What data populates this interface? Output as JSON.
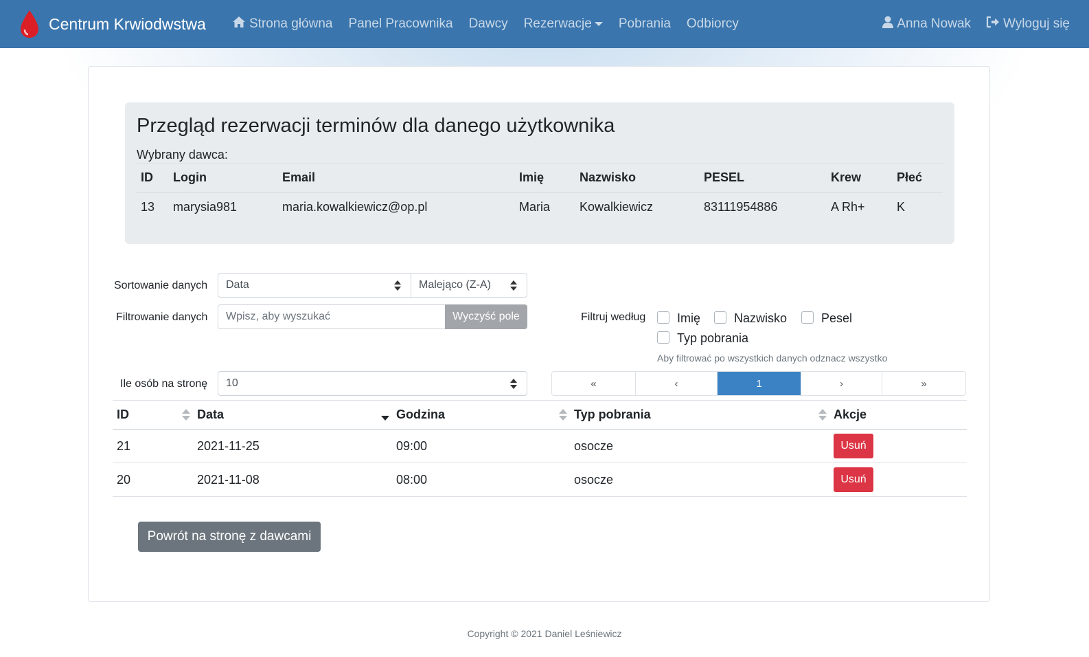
{
  "navbar": {
    "brand": "Centrum Krwiodwstwa",
    "links": [
      "Strona główna",
      "Panel Pracownika",
      "Dawcy",
      "Rezerwacje",
      "Pobrania",
      "Odbiorcy"
    ],
    "user": "Anna Nowak",
    "logout": "Wyloguj się",
    "color": "#3a75ad"
  },
  "header": {
    "title": "Przegląd rezerwacji terminów dla danego użytkownika",
    "subtitle": "Wybrany dawca:"
  },
  "donor": {
    "columns": [
      "ID",
      "Login",
      "Email",
      "Imię",
      "Nazwisko",
      "PESEL",
      "Krew",
      "Płeć"
    ],
    "row": [
      "13",
      "marysia981",
      "maria.kowalkiewicz@op.pl",
      "Maria",
      "Kowalkiewicz",
      "83111954886",
      "A Rh+",
      "K"
    ]
  },
  "controls": {
    "sort_label": "Sortowanie danych",
    "sort_field": "Data",
    "sort_order": "Malejąco (Z-A)",
    "filter_label": "Filtrowanie danych",
    "filter_placeholder": "Wpisz, aby wyszukać",
    "clear_button": "Wyczyść pole",
    "filter_by_label": "Filtruj według",
    "filter_options": [
      "Imię",
      "Nazwisko",
      "Pesel",
      "Typ pobrania"
    ],
    "filter_hint": "Aby filtrować po wszystkich danych odznacz wszystko",
    "per_page_label": "Ile osób na stronę",
    "per_page_value": "10"
  },
  "pagination": {
    "first": "«",
    "prev": "‹",
    "current": "1",
    "next": "›",
    "last": "»",
    "active_color": "#3a82c4"
  },
  "reservations": {
    "columns": [
      "ID",
      "Data",
      "Godzina",
      "Typ pobrania",
      "Akcje"
    ],
    "rows": [
      {
        "id": "21",
        "date": "2021-11-25",
        "time": "09:00",
        "type": "osocze",
        "action": "Usuń"
      },
      {
        "id": "20",
        "date": "2021-11-08",
        "time": "08:00",
        "type": "osocze",
        "action": "Usuń"
      }
    ],
    "delete_color": "#dc3545"
  },
  "back_button": "Powrót na stronę z dawcami",
  "footer": "Copyright © 2021 Daniel Leśniewicz"
}
